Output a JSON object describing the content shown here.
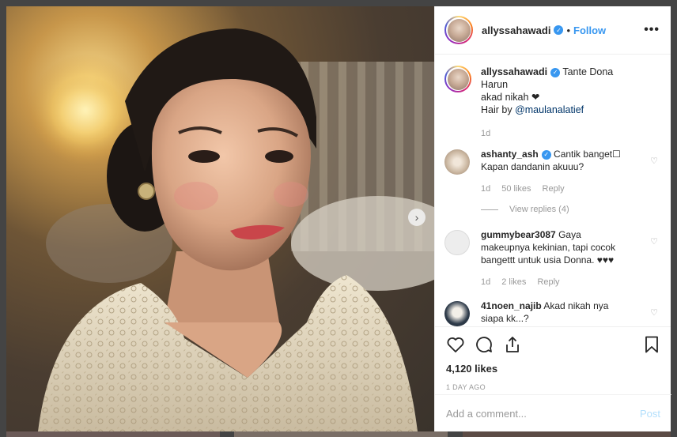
{
  "post": {
    "username": "allyssahawadi",
    "follow_label": "Follow",
    "dot": "•",
    "more_label": "•••",
    "caption_line1": "Tante Dona Harun",
    "caption_line2": "akad nikah ❤",
    "caption_line3_prefix": "Hair by",
    "caption_mention": "@maulanalatief",
    "caption_time": "1d",
    "likes": "4,120 likes",
    "posted_ago": "1 DAY AGO"
  },
  "comments": [
    {
      "username": "ashanty_ash",
      "verified": true,
      "text_line1": "Cantik banget☐",
      "text_line2": "Kapan dandanin akuuu?",
      "time": "1d",
      "likes": "50 likes",
      "reply_label": "Reply",
      "view_replies": "View replies (4)"
    },
    {
      "username": "gummybear3087",
      "verified": false,
      "text_line1": "Gaya",
      "text_line2": "makeupnya kekinian, tapi cocok",
      "text_line3": "bangettt untuk usia Donna. ♥♥♥",
      "time": "1d",
      "likes": "2 likes",
      "reply_label": "Reply"
    },
    {
      "username": "41noen_najib",
      "verified": false,
      "text_line1": "Akad nikah nya",
      "text_line2": "siapa kk...?"
    }
  ],
  "add_comment": {
    "placeholder": "Add a comment...",
    "post_label": "Post"
  },
  "icons": {
    "verified": "verified-badge-icon",
    "heart": "heart-icon",
    "comment": "comment-icon",
    "share": "share-icon",
    "save": "bookmark-icon",
    "next": "chevron-right-icon"
  },
  "colors": {
    "accent": "#3897f0",
    "post_disabled": "#b2dffc",
    "muted": "#999999"
  }
}
